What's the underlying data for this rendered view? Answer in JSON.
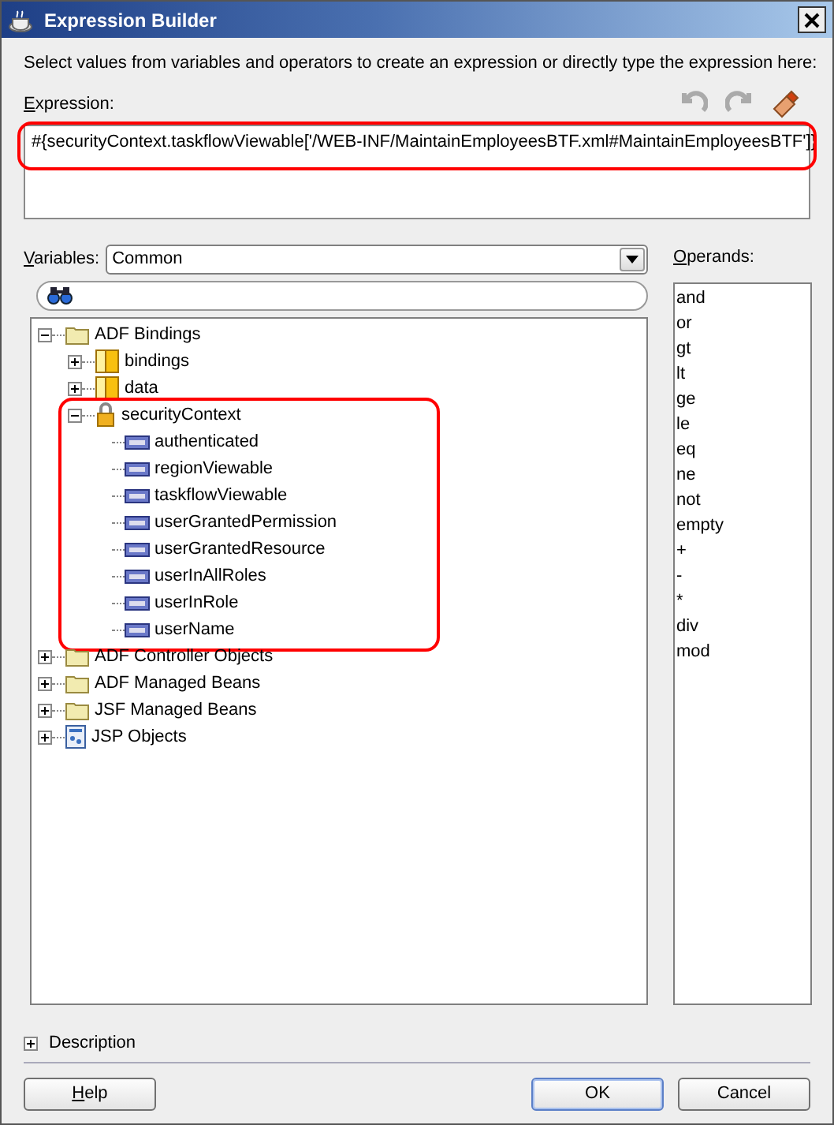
{
  "window": {
    "title": "Expression Builder"
  },
  "instructions": "Select values from variables and operators to create an expression or directly type the expression here:",
  "expression": {
    "label": "Expression:",
    "value": "#{securityContext.taskflowViewable['/WEB-INF/MaintainEmployeesBTF.xml#MaintainEmployeesBTF']}",
    "highlighted": true
  },
  "variables": {
    "label": "Variables:",
    "value": "Common"
  },
  "tree": [
    {
      "label": "ADF Bindings",
      "kind": "folder",
      "expanded": true,
      "highlighted": false,
      "children": [
        {
          "label": "bindings",
          "kind": "bean",
          "expanded": false,
          "highlighted": false
        },
        {
          "label": "data",
          "kind": "bean",
          "expanded": false,
          "highlighted": false
        },
        {
          "label": "securityContext",
          "kind": "lock",
          "expanded": true,
          "highlighted": true,
          "children": [
            {
              "label": "authenticated",
              "kind": "property"
            },
            {
              "label": "regionViewable",
              "kind": "property"
            },
            {
              "label": "taskflowViewable",
              "kind": "property"
            },
            {
              "label": "userGrantedPermission",
              "kind": "property"
            },
            {
              "label": "userGrantedResource",
              "kind": "property"
            },
            {
              "label": "userInAllRoles",
              "kind": "property"
            },
            {
              "label": "userInRole",
              "kind": "property"
            },
            {
              "label": "userName",
              "kind": "property"
            }
          ]
        }
      ]
    },
    {
      "label": "ADF Controller Objects",
      "kind": "folder",
      "expanded": false,
      "highlighted": false
    },
    {
      "label": "ADF Managed Beans",
      "kind": "folder",
      "expanded": false,
      "highlighted": false
    },
    {
      "label": "JSF Managed Beans",
      "kind": "folder",
      "expanded": false,
      "highlighted": false
    },
    {
      "label": "JSP Objects",
      "kind": "page",
      "expanded": false,
      "highlighted": false
    }
  ],
  "operands": {
    "label": "Operands:",
    "items": [
      "and",
      "or",
      "gt",
      "lt",
      "ge",
      "le",
      "eq",
      "ne",
      "not",
      "empty",
      "+",
      "-",
      "*",
      "div",
      "mod"
    ]
  },
  "description": {
    "label": "Description",
    "expanded": false
  },
  "buttons": [
    {
      "label": "Help",
      "default": false
    },
    {
      "label": "OK",
      "default": true
    },
    {
      "label": "Cancel",
      "default": false
    }
  ]
}
